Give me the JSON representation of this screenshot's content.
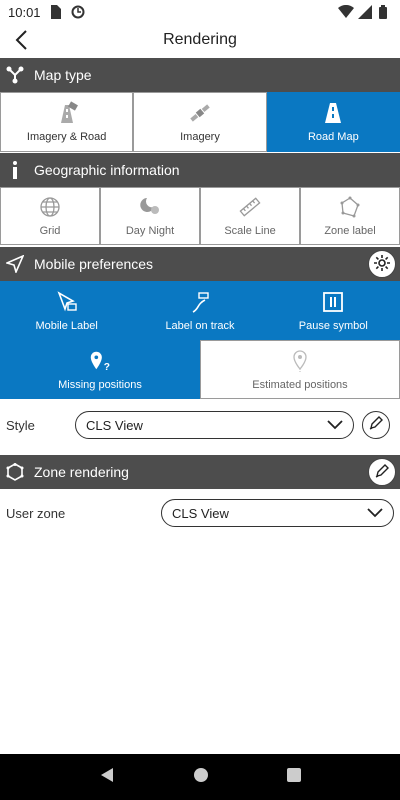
{
  "status_bar": {
    "time": "10:01"
  },
  "app_bar": {
    "title": "Rendering"
  },
  "map_type": {
    "header": "Map type",
    "options": [
      {
        "label": "Imagery & Road",
        "icon": "imagery-road-icon",
        "selected": false
      },
      {
        "label": "Imagery",
        "icon": "satellite-icon",
        "selected": false
      },
      {
        "label": "Road Map",
        "icon": "road-icon",
        "selected": true
      }
    ]
  },
  "geo_info": {
    "header": "Geographic information",
    "options": [
      {
        "label": "Grid",
        "icon": "globe-grid-icon"
      },
      {
        "label": "Day Night",
        "icon": "day-night-icon"
      },
      {
        "label": "Scale Line",
        "icon": "ruler-icon"
      },
      {
        "label": "Zone label",
        "icon": "polygon-icon"
      }
    ]
  },
  "mobile_prefs": {
    "header": "Mobile preferences",
    "options_row1": [
      {
        "label": "Mobile Label",
        "icon": "cursor-label-icon",
        "selected": true
      },
      {
        "label": "Label on track",
        "icon": "track-label-icon",
        "selected": true
      },
      {
        "label": "Pause symbol",
        "icon": "pause-icon",
        "selected": true
      }
    ],
    "options_row2": [
      {
        "label": "Missing positions",
        "icon": "missing-position-icon",
        "selected": true
      },
      {
        "label": "Estimated positions",
        "icon": "estimated-position-icon",
        "selected": false
      }
    ],
    "style_label": "Style",
    "style_value": "CLS View"
  },
  "zone_rendering": {
    "header": "Zone rendering",
    "user_zone_label": "User zone",
    "user_zone_value": "CLS View"
  },
  "colors": {
    "accent": "#0a78c2",
    "header_bg": "#4d4d4d"
  }
}
